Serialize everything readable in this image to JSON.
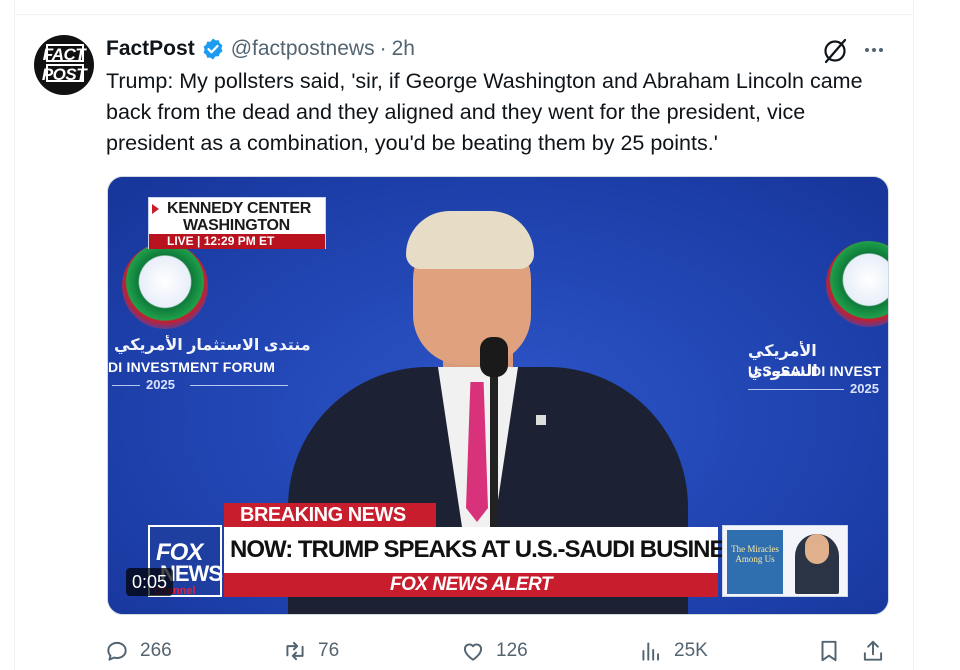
{
  "post": {
    "author_name": "FactPost",
    "handle": "@factpostnews",
    "separator": "·",
    "time": "2h",
    "avatar_line1": "FACT",
    "avatar_line2": "POST",
    "text": "Trump: My pollsters said, 'sir, if George Washington and Abraham Lincoln came back from the dead and they aligned and they went for the president, vice president as a combination, you'd be beating them by 25 points.'"
  },
  "video": {
    "duration": "0:05",
    "location_line1": "KENNEDY CENTER",
    "location_line2": "WASHINGTON",
    "live_label": "LIVE | 12:29 PM ET",
    "banner_label": "BREAKING NEWS",
    "headline": "NOW: TRUMP SPEAKS AT U.S.-SAUDI BUSINESS FORUM",
    "alert_label": "FOX NEWS ALERT",
    "network_line1": "FOX",
    "network_line2": "NEWS",
    "network_line3": "channel",
    "book_title": "The Miracles Among Us",
    "forum_left_ar": "منتدى الاستثمار الأمريكي",
    "forum_left_en": "DI INVESTMENT FORUM",
    "forum_left_year": "2025",
    "forum_right_ar": "الأمريكي السعودي",
    "forum_right_en": "U.S.-SAUDI INVEST",
    "forum_right_year": "2025"
  },
  "actions": {
    "replies": "266",
    "reposts": "76",
    "likes": "126",
    "views": "25K"
  },
  "colors": {
    "brand_blue": "#1d9bf0",
    "muted_text": "#536471",
    "fox_red": "#c81d2c"
  },
  "icons": [
    "verified-badge-icon",
    "grok-icon",
    "more-icon",
    "reply-icon",
    "repost-icon",
    "like-icon",
    "views-icon",
    "bookmark-icon",
    "share-icon"
  ]
}
